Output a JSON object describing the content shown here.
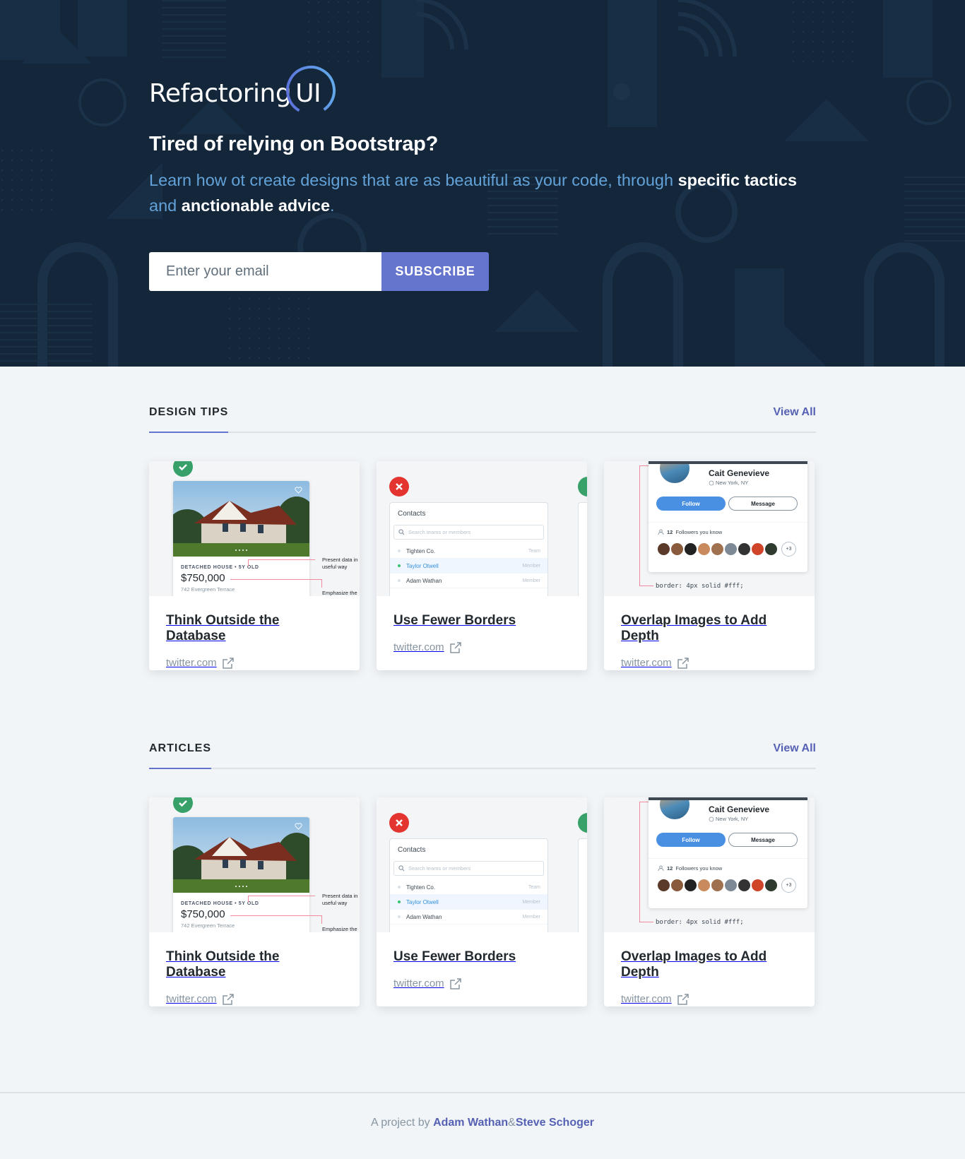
{
  "hero": {
    "logo_text": "Refactoring",
    "logo_ui": "UI",
    "title": "Tired of relying on Bootstrap?",
    "subtitle_1": "Learn how ot create designs that are as beautiful as your code, through ",
    "subtitle_bold_1": "specific tactics",
    "subtitle_2": " and ",
    "subtitle_bold_2": "anctionable advice",
    "subtitle_3": ".",
    "email_placeholder": "Enter your email",
    "subscribe_label": "SUBSCRIBE"
  },
  "sections": [
    {
      "title": "DESIGN TIPS",
      "view_all": "View All",
      "cards": [
        {
          "title": "Think Outside the Database",
          "source": "twitter.com"
        },
        {
          "title": "Use Fewer Borders",
          "source": "twitter.com"
        },
        {
          "title": "Overlap Images to Add Depth",
          "source": "twitter.com"
        }
      ]
    },
    {
      "title": "ARTICLES",
      "view_all": "View All",
      "cards": [
        {
          "title": "Think Outside the Database",
          "source": "twitter.com"
        },
        {
          "title": "Use Fewer Borders",
          "source": "twitter.com"
        },
        {
          "title": "Overlap Images to Add Depth",
          "source": "twitter.com"
        }
      ]
    }
  ],
  "thumb_house": {
    "label": "DETACHED HOUSE • 5Y OLD",
    "price": "$750,000",
    "address": "742 Evergreen Terrace",
    "annotation_1a": "Present data in",
    "annotation_1b": "useful way",
    "annotation_2": "Emphasize the"
  },
  "thumb_contacts": {
    "title": "Contacts",
    "search_placeholder": "Search teams or members",
    "rows": [
      {
        "name": "Tighten Co.",
        "role": "Team"
      },
      {
        "name": "Taylor Otwell",
        "role": "Member"
      },
      {
        "name": "Adam Wathan",
        "role": "Member"
      }
    ]
  },
  "thumb_profile": {
    "name": "Cait Genevieve",
    "location": "New York, NY",
    "follow": "Follow",
    "message": "Message",
    "followers_count": "12",
    "followers_text": "Followers you know",
    "more": "+3",
    "code": "border: 4px solid #fff;"
  },
  "footer": {
    "prefix": "A project by ",
    "author_1": "Adam Wathan",
    "separator": " & ",
    "author_2": "Steve Schoger"
  },
  "colors": {
    "hero_bg": "#13263a",
    "accent": "#6574cd",
    "link": "#5661b3",
    "subtitle": "#63a2d8",
    "page_bg": "#f1f5f8"
  }
}
